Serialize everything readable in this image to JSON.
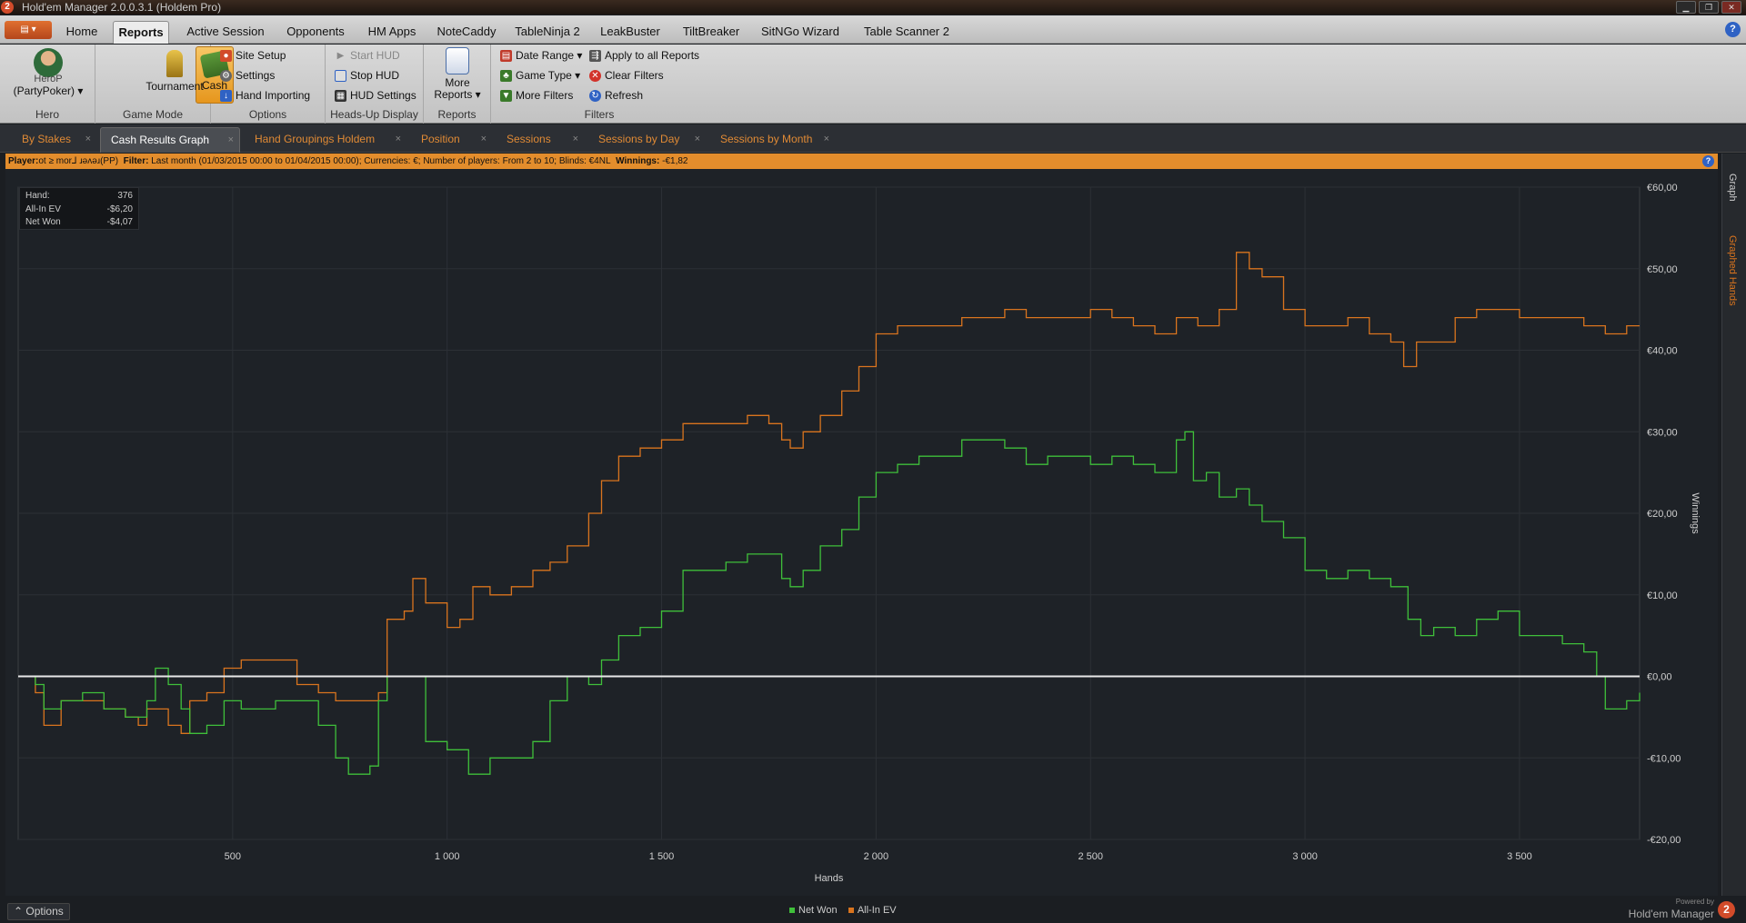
{
  "window": {
    "title": "Hold'em Manager 2.0.0.3.1 (Holdem Pro)",
    "logo": "2"
  },
  "menu": {
    "app_button": "▤ ▾",
    "tabs": [
      "Home",
      "Reports",
      "Active Session",
      "Opponents",
      "HM Apps",
      "NoteCaddy",
      "TableNinja 2",
      "LeakBuster",
      "TiltBreaker",
      "SitNGo Wizard",
      "Table Scanner 2"
    ],
    "active": "Reports",
    "help": "?"
  },
  "ribbon": {
    "hero": {
      "name": "HeroP",
      "site": "(PartyPoker) ▾",
      "label": "Hero"
    },
    "game_mode": {
      "cash": "Cash",
      "tournament": "Tournament",
      "label": "Game Mode"
    },
    "options": {
      "site_setup": "Site Setup",
      "settings": "Settings",
      "hand_importing": "Hand Importing",
      "label": "Options"
    },
    "hud": {
      "start": "Start HUD",
      "stop": "Stop HUD",
      "settings": "HUD Settings",
      "label": "Heads-Up Display"
    },
    "reports": {
      "more1": "More",
      "more2": "Reports ▾",
      "label": "Reports"
    },
    "filters": {
      "date_range": "Date Range ▾",
      "game_type": "Game Type ▾",
      "more_filters": "More Filters",
      "apply_all": "Apply to all Reports",
      "clear": "Clear Filters",
      "refresh": "Refresh",
      "label": "Filters"
    }
  },
  "report_tabs": [
    "By Stakes",
    "Cash Results Graph",
    "Hand Groupings Holdem",
    "Position",
    "Sessions",
    "Sessions by Day",
    "Sessions by Month"
  ],
  "active_report_tab": "Cash Results Graph",
  "filter_bar": {
    "player_label": "Player:",
    "player": "ot ≥ mor⅃ ɹəʌəɹ(PP)",
    "filter_label": "Filter:",
    "filter": "Last month (01/03/2015 00:00 to 01/04/2015 00:00); Currencies: €; Number of players: From 2 to 10; Blinds: €4NL",
    "winnings_label": "Winnings:",
    "winnings": "-€1,82"
  },
  "sidebar": {
    "graph": "Graph",
    "graphed_hands": "Graphed Hands"
  },
  "info_box": [
    {
      "label": "Hand:",
      "value": "376"
    },
    {
      "label": "All-In EV",
      "value": "-$6,20"
    },
    {
      "label": "Net Won",
      "value": "-$4,07"
    }
  ],
  "bottom": {
    "options": "⌃ Options",
    "powered": "Powered by",
    "brand": "Hold'em Manager",
    "logo": "2"
  },
  "colors": {
    "net_won": "#3fbf3a",
    "all_in_ev": "#d9741e",
    "zero_line": "#e8e8e8",
    "accent": "#e38d2c"
  },
  "chart_data": {
    "type": "line",
    "xlabel": "Hands",
    "ylabel": "Winnings",
    "xlim": [
      0,
      3780
    ],
    "ylim": [
      -20,
      60
    ],
    "x_ticks": [
      500,
      1000,
      1500,
      2000,
      2500,
      3000,
      3500
    ],
    "x_tick_labels": [
      "500",
      "1 000",
      "1 500",
      "2 000",
      "2 500",
      "3 000",
      "3 500"
    ],
    "y_ticks": [
      60,
      50,
      40,
      30,
      20,
      10,
      0,
      -10,
      -20
    ],
    "y_tick_labels": [
      "€60,00",
      "€50,00",
      "€40,00",
      "€30,00",
      "€20,00",
      "€10,00",
      "€0,00",
      "-€10,00",
      "-€20,00"
    ],
    "grid": true,
    "legend": "bottom-center",
    "series": [
      {
        "name": "Net Won",
        "points": [
          [
            0,
            0
          ],
          [
            40,
            -1
          ],
          [
            60,
            -4
          ],
          [
            100,
            -3
          ],
          [
            150,
            -2
          ],
          [
            200,
            -4
          ],
          [
            250,
            -5
          ],
          [
            300,
            -3
          ],
          [
            320,
            1
          ],
          [
            350,
            -1
          ],
          [
            380,
            -4
          ],
          [
            400,
            -7
          ],
          [
            440,
            -6
          ],
          [
            480,
            -3
          ],
          [
            520,
            -4
          ],
          [
            600,
            -3
          ],
          [
            650,
            -3
          ],
          [
            700,
            -6
          ],
          [
            740,
            -10
          ],
          [
            770,
            -12
          ],
          [
            820,
            -11
          ],
          [
            840,
            -3
          ],
          [
            860,
            0
          ],
          [
            900,
            0
          ],
          [
            950,
            -8
          ],
          [
            1000,
            -9
          ],
          [
            1050,
            -12
          ],
          [
            1100,
            -10
          ],
          [
            1150,
            -10
          ],
          [
            1200,
            -8
          ],
          [
            1240,
            -3
          ],
          [
            1280,
            0
          ],
          [
            1330,
            -1
          ],
          [
            1360,
            2
          ],
          [
            1400,
            5
          ],
          [
            1450,
            6
          ],
          [
            1500,
            8
          ],
          [
            1550,
            13
          ],
          [
            1600,
            13
          ],
          [
            1650,
            14
          ],
          [
            1700,
            15
          ],
          [
            1750,
            15
          ],
          [
            1780,
            12
          ],
          [
            1800,
            11
          ],
          [
            1830,
            13
          ],
          [
            1870,
            16
          ],
          [
            1920,
            18
          ],
          [
            1960,
            22
          ],
          [
            2000,
            25
          ],
          [
            2050,
            26
          ],
          [
            2100,
            27
          ],
          [
            2150,
            27
          ],
          [
            2200,
            29
          ],
          [
            2250,
            29
          ],
          [
            2300,
            28
          ],
          [
            2350,
            26
          ],
          [
            2400,
            27
          ],
          [
            2450,
            27
          ],
          [
            2500,
            26
          ],
          [
            2550,
            27
          ],
          [
            2600,
            26
          ],
          [
            2650,
            25
          ],
          [
            2700,
            29
          ],
          [
            2720,
            30
          ],
          [
            2740,
            24
          ],
          [
            2770,
            25
          ],
          [
            2800,
            22
          ],
          [
            2840,
            23
          ],
          [
            2870,
            21
          ],
          [
            2900,
            19
          ],
          [
            2950,
            17
          ],
          [
            3000,
            13
          ],
          [
            3050,
            12
          ],
          [
            3100,
            13
          ],
          [
            3150,
            12
          ],
          [
            3200,
            11
          ],
          [
            3240,
            7
          ],
          [
            3270,
            5
          ],
          [
            3300,
            6
          ],
          [
            3350,
            5
          ],
          [
            3400,
            7
          ],
          [
            3450,
            8
          ],
          [
            3500,
            5
          ],
          [
            3550,
            5
          ],
          [
            3600,
            4
          ],
          [
            3650,
            3
          ],
          [
            3680,
            0
          ],
          [
            3700,
            -4
          ],
          [
            3750,
            -3
          ],
          [
            3780,
            -2
          ]
        ]
      },
      {
        "name": "All-In EV",
        "points": [
          [
            0,
            0
          ],
          [
            40,
            -2
          ],
          [
            60,
            -6
          ],
          [
            100,
            -3
          ],
          [
            150,
            -3
          ],
          [
            200,
            -4
          ],
          [
            250,
            -5
          ],
          [
            280,
            -6
          ],
          [
            300,
            -4
          ],
          [
            350,
            -6
          ],
          [
            380,
            -7
          ],
          [
            400,
            -3
          ],
          [
            440,
            -2
          ],
          [
            480,
            1
          ],
          [
            520,
            2
          ],
          [
            600,
            2
          ],
          [
            650,
            -1
          ],
          [
            700,
            -2
          ],
          [
            740,
            -3
          ],
          [
            800,
            -3
          ],
          [
            840,
            -2
          ],
          [
            860,
            7
          ],
          [
            900,
            8
          ],
          [
            920,
            12
          ],
          [
            950,
            9
          ],
          [
            1000,
            6
          ],
          [
            1030,
            7
          ],
          [
            1060,
            11
          ],
          [
            1100,
            10
          ],
          [
            1150,
            11
          ],
          [
            1200,
            13
          ],
          [
            1240,
            14
          ],
          [
            1280,
            16
          ],
          [
            1330,
            20
          ],
          [
            1360,
            24
          ],
          [
            1400,
            27
          ],
          [
            1450,
            28
          ],
          [
            1500,
            29
          ],
          [
            1550,
            31
          ],
          [
            1600,
            31
          ],
          [
            1650,
            31
          ],
          [
            1700,
            32
          ],
          [
            1750,
            31
          ],
          [
            1780,
            29
          ],
          [
            1800,
            28
          ],
          [
            1830,
            30
          ],
          [
            1870,
            32
          ],
          [
            1920,
            35
          ],
          [
            1960,
            38
          ],
          [
            2000,
            42
          ],
          [
            2050,
            43
          ],
          [
            2100,
            43
          ],
          [
            2150,
            43
          ],
          [
            2200,
            44
          ],
          [
            2250,
            44
          ],
          [
            2300,
            45
          ],
          [
            2350,
            44
          ],
          [
            2400,
            44
          ],
          [
            2450,
            44
          ],
          [
            2500,
            45
          ],
          [
            2550,
            44
          ],
          [
            2600,
            43
          ],
          [
            2650,
            42
          ],
          [
            2700,
            44
          ],
          [
            2750,
            43
          ],
          [
            2800,
            45
          ],
          [
            2840,
            52
          ],
          [
            2870,
            50
          ],
          [
            2900,
            49
          ],
          [
            2950,
            45
          ],
          [
            3000,
            43
          ],
          [
            3050,
            43
          ],
          [
            3100,
            44
          ],
          [
            3150,
            42
          ],
          [
            3200,
            41
          ],
          [
            3230,
            38
          ],
          [
            3260,
            41
          ],
          [
            3300,
            41
          ],
          [
            3350,
            44
          ],
          [
            3400,
            45
          ],
          [
            3450,
            45
          ],
          [
            3500,
            44
          ],
          [
            3550,
            44
          ],
          [
            3600,
            44
          ],
          [
            3650,
            43
          ],
          [
            3700,
            42
          ],
          [
            3750,
            43
          ],
          [
            3780,
            43
          ]
        ]
      }
    ]
  }
}
